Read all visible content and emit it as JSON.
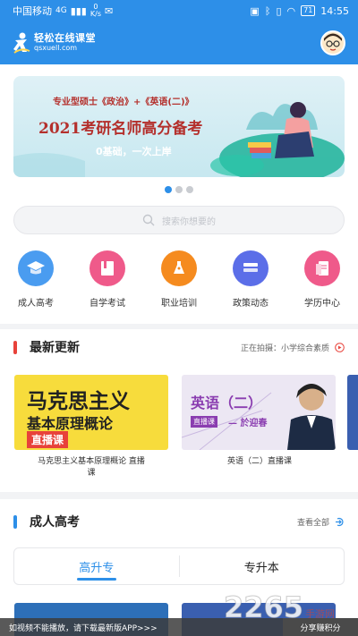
{
  "status_bar": {
    "carrier": "中国移动",
    "network": "4G",
    "speed_value": "0",
    "speed_unit": "K/s",
    "battery": "71",
    "time": "14:55"
  },
  "header": {
    "logo_cn": "轻松在线课堂",
    "logo_en": "qsxuell.com"
  },
  "banner": {
    "line1": "专业型硕士《政治》+《英语(二)》",
    "line2": "2021考研名师高分备考",
    "line3": "0基础，一次上岸"
  },
  "carousel": {
    "count": 3,
    "active": 0
  },
  "search": {
    "placeholder": "搜索你想要的"
  },
  "categories": [
    {
      "label": "成人高考",
      "icon": "graduation-cap-icon",
      "color": "#4a9cf0"
    },
    {
      "label": "自学考试",
      "icon": "book-icon",
      "color": "#ef5a8a"
    },
    {
      "label": "职业培训",
      "icon": "pen-icon",
      "color": "#f58b1f"
    },
    {
      "label": "政策动态",
      "icon": "stack-icon",
      "color": "#5b6ee8"
    },
    {
      "label": "学历中心",
      "icon": "document-icon",
      "color": "#ef5a8a"
    }
  ],
  "latest": {
    "title": "最新更新",
    "filming_label": "正在拍摄：小学综合素质",
    "courses": [
      {
        "cover_title1": "马克思主义",
        "cover_title2": "基本原理概论",
        "cover_tag": "直播课",
        "caption1": "马克思主义基本原理概论 直播",
        "caption2": "课"
      },
      {
        "cover_title": "英语（二）",
        "cover_tag": "直播课",
        "cover_teacher": "— 於迎春",
        "caption1": "英语（二）直播课"
      }
    ]
  },
  "adult_exam": {
    "title": "成人高考",
    "view_all": "查看全部",
    "tabs": [
      "高升专",
      "专升本"
    ],
    "active_tab": 0
  },
  "notice": {
    "text": "如视频不能播放，请下载最新版APP>>>",
    "share": "分享赚积分"
  },
  "watermark": {
    "num": "2265",
    "text": "手游网"
  },
  "colors": {
    "primary": "#2d8fe8",
    "section_red": "#e8423a",
    "section_blue": "#2d8fe8"
  }
}
